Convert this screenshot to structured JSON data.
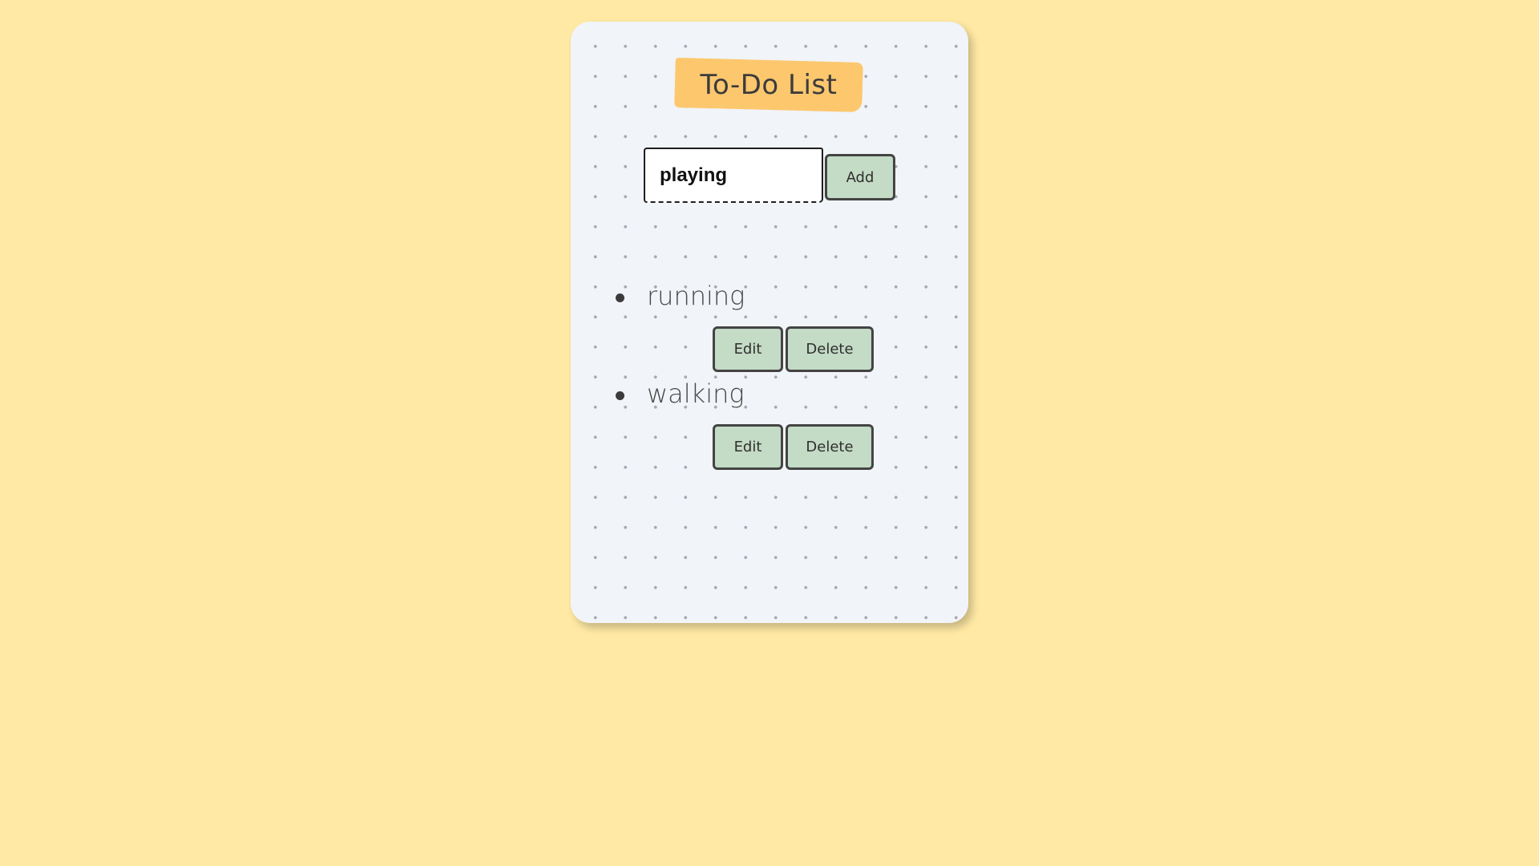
{
  "app": {
    "title": "To-Do List"
  },
  "input": {
    "value": "playing",
    "placeholder": ""
  },
  "buttons": {
    "add_label": "Add"
  },
  "tasks": [
    {
      "label": "running",
      "edit_label": "Edit",
      "delete_label": "Delete"
    },
    {
      "label": "walking",
      "edit_label": "Edit",
      "delete_label": "Delete"
    }
  ],
  "colors": {
    "page_background": "#ffe9a4",
    "card_background": "#f1f4f8",
    "title_tag": "#fdc76e",
    "button_fill": "#c4dbc5",
    "button_border": "#444444"
  },
  "icons": {
    "task_bullet": "bullet-dot-icon"
  }
}
